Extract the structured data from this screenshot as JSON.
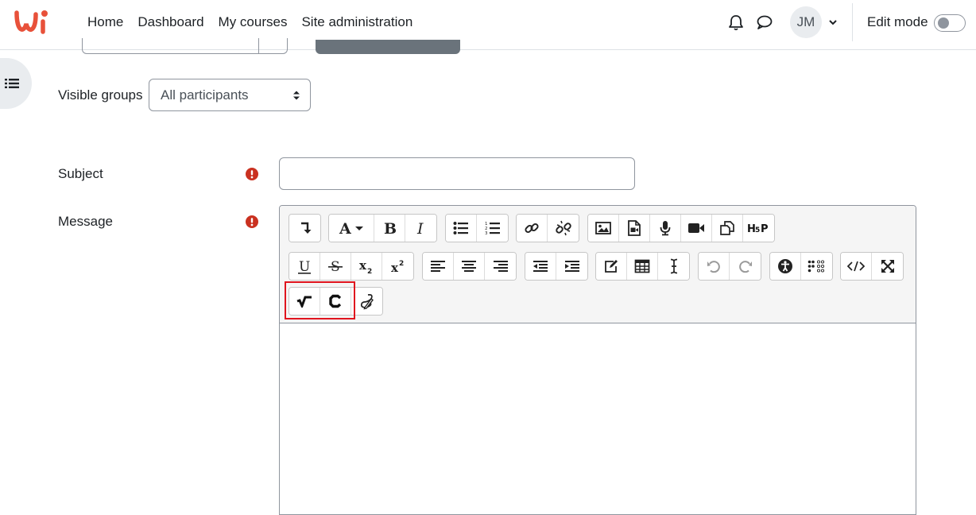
{
  "nav": {
    "items": [
      "Home",
      "Dashboard",
      "My courses",
      "Site administration"
    ],
    "user_initials": "JM",
    "edit_mode_label": "Edit mode",
    "edit_mode_on": false,
    "logo": "wi-logo",
    "icons": [
      "bell-icon",
      "chat-icon",
      "chevron-down-icon"
    ]
  },
  "form": {
    "visible_groups": {
      "label": "Visible groups",
      "value": "All participants"
    },
    "subject": {
      "label": "Subject",
      "value": "",
      "required": true
    },
    "message": {
      "label": "Message",
      "value": "",
      "required": true
    }
  },
  "editor": {
    "toolbar_rows": [
      [
        "toolbar-toggle",
        "font-style",
        "bold",
        "italic",
        "bullet-list",
        "numbered-list",
        "link",
        "unlink",
        "image",
        "media",
        "record-audio",
        "record-video",
        "manage-files",
        "h5p"
      ],
      [
        "underline",
        "strikethrough",
        "subscript",
        "superscript",
        "align-left",
        "align-center",
        "align-right",
        "outdent",
        "indent",
        "equation",
        "table",
        "clear-formatting",
        "undo",
        "redo",
        "accessibility-checker",
        "screenreader-helper",
        "html",
        "fullscreen"
      ],
      [
        "wiris-math",
        "wiris-chem",
        "handwriting"
      ]
    ],
    "highlighted_buttons": [
      "wiris-math",
      "wiris-chem"
    ]
  },
  "colors": {
    "brand": "#e8513a",
    "required": "#ca3120",
    "highlight": "#e0141e",
    "toolbar_bg": "#f5f5f5"
  }
}
